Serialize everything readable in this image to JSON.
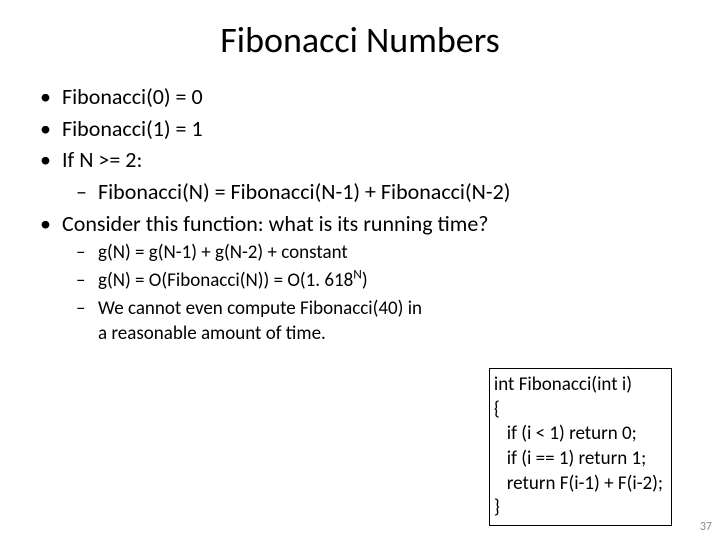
{
  "title": "Fibonacci Numbers",
  "bullets": {
    "b1": "Fibonacci(0) = 0",
    "b2": "Fibonacci(1) = 1",
    "b3": "If N >= 2:",
    "b3a": "Fibonacci(N) = Fibonacci(N-1) + Fibonacci(N-2)",
    "b4": "Consider this function: what is its running time?",
    "b4a": "g(N) = g(N-1) + g(N-2) + constant",
    "b4b_pre": "g(N) = O(Fibonacci(N))  = O(1. 618",
    "b4b_sup": "N",
    "b4b_post": ")",
    "b4c": "We cannot even compute Fibonacci(40) in a reasonable amount of time."
  },
  "code": {
    "l1": "int Fibonacci(int i)",
    "l2": "{",
    "l3": "   if (i < 1) return 0;",
    "l4": "   if (i == 1) return 1;",
    "l5": "   return F(i-1) + F(i-2);",
    "l6": "}"
  },
  "page": "37"
}
